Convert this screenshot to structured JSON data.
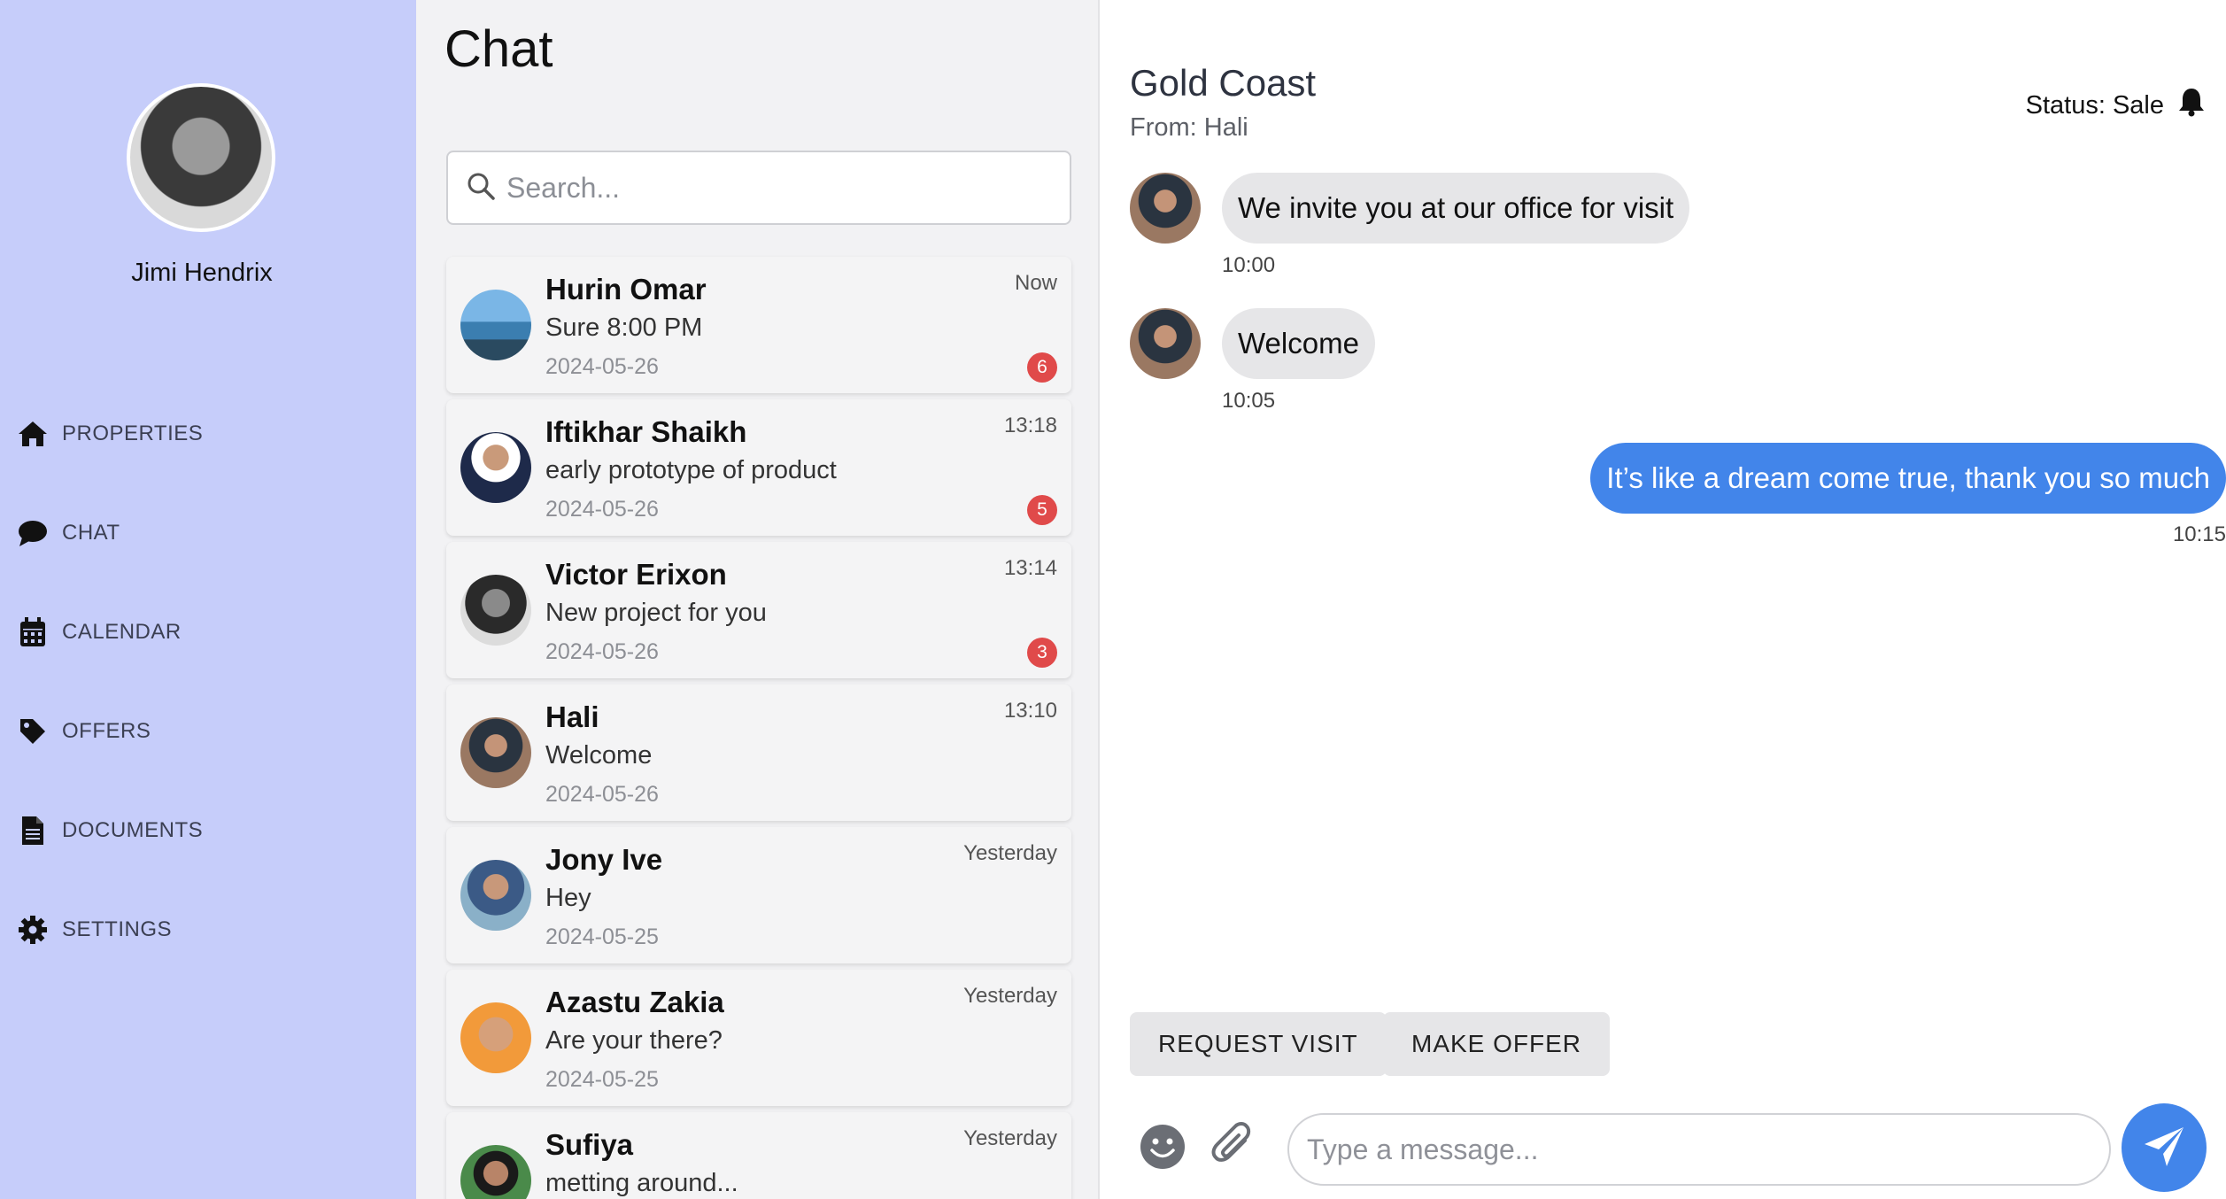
{
  "profile": {
    "name": "Jimi Hendrix"
  },
  "nav": [
    {
      "label": "PROPERTIES",
      "icon": "home-icon"
    },
    {
      "label": "CHAT",
      "icon": "chat-bubble-icon"
    },
    {
      "label": "CALENDAR",
      "icon": "calendar-icon"
    },
    {
      "label": "OFFERS",
      "icon": "tag-icon"
    },
    {
      "label": "DOCUMENTS",
      "icon": "document-icon"
    },
    {
      "label": "SETTINGS",
      "icon": "gear-icon"
    }
  ],
  "chatlist": {
    "title": "Chat",
    "search_placeholder": "Search...",
    "conversations": [
      {
        "name": "Hurin Omar",
        "preview": "Sure 8:00 PM",
        "date": "2024-05-26",
        "time": "Now",
        "badge": "6"
      },
      {
        "name": "Iftikhar Shaikh",
        "preview": "early prototype of product",
        "date": "2024-05-26",
        "time": "13:18",
        "badge": "5"
      },
      {
        "name": "Victor Erixon",
        "preview": "New project for you",
        "date": "2024-05-26",
        "time": "13:14",
        "badge": "3"
      },
      {
        "name": "Hali",
        "preview": "Welcome",
        "date": "2024-05-26",
        "time": "13:10",
        "badge": ""
      },
      {
        "name": "Jony Ive",
        "preview": "Hey",
        "date": "2024-05-25",
        "time": "Yesterday",
        "badge": ""
      },
      {
        "name": "Azastu Zakia",
        "preview": "Are your there?",
        "date": "2024-05-25",
        "time": "Yesterday",
        "badge": ""
      },
      {
        "name": "Sufiya",
        "preview": "metting around...",
        "date": "",
        "time": "Yesterday",
        "badge": ""
      }
    ]
  },
  "conversation": {
    "title": "Gold Coast",
    "from": "From: Hali",
    "status": "Status: Sale",
    "messages": [
      {
        "text": "We invite you at our office for visit",
        "time": "10:00",
        "direction": "in"
      },
      {
        "text": "Welcome",
        "time": "10:05",
        "direction": "in"
      },
      {
        "text": "It’s like a dream come true, thank you so much",
        "time": "10:15",
        "direction": "out"
      }
    ],
    "actions": {
      "request_visit": "REQUEST VISIT",
      "make_offer": "MAKE OFFER"
    },
    "input_placeholder": "Type a message..."
  },
  "colors": {
    "sidebar_bg": "#c6cdfa",
    "accent": "#4285ea",
    "badge": "#e04a4a"
  }
}
